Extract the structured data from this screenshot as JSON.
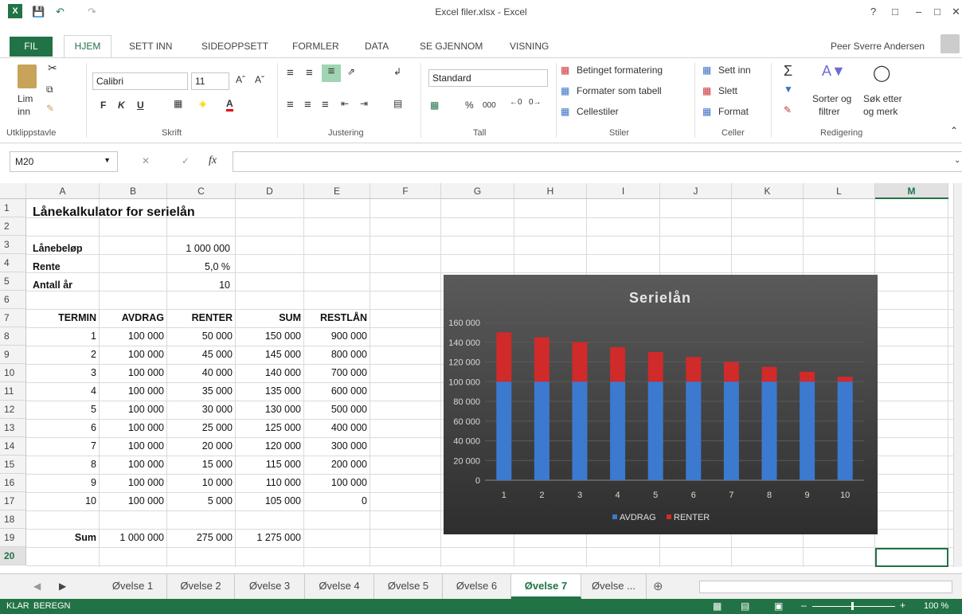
{
  "window": {
    "title": "Excel filer.xlsx - Excel",
    "user": "Peer Sverre Andersen"
  },
  "tabs": [
    "FIL",
    "HJEM",
    "SETT INN",
    "SIDEOPPSETT",
    "FORMLER",
    "DATA",
    "SE GJENNOM",
    "VISNING"
  ],
  "ribbon": {
    "clipboard": {
      "paste": "Lim",
      "paste2": "inn",
      "group": "Utklippstavle"
    },
    "font": {
      "name": "Calibri",
      "size": "11",
      "bold": "F",
      "italic": "K",
      "underline": "U",
      "group": "Skrift"
    },
    "alignment": {
      "group": "Justering"
    },
    "number": {
      "format": "Standard",
      "percent": "%",
      "thousands": "000",
      "group": "Tall"
    },
    "styles": {
      "cond": "Betinget formatering",
      "table": "Formater som tabell",
      "cell": "Cellestiler",
      "group": "Stiler"
    },
    "cells": {
      "insert": "Sett inn",
      "delete": "Slett",
      "format": "Format",
      "group": "Celler"
    },
    "editing": {
      "sort1": "Sorter og",
      "sort2": "filtrer",
      "find1": "Søk etter",
      "find2": "og merk",
      "group": "Redigering"
    }
  },
  "formula": {
    "namebox": "M20",
    "fx": "fx",
    "value": ""
  },
  "columns": [
    "A",
    "B",
    "C",
    "D",
    "E",
    "F",
    "G",
    "H",
    "I",
    "J",
    "K",
    "L",
    "M"
  ],
  "rows": [
    "1",
    "2",
    "3",
    "4",
    "5",
    "6",
    "7",
    "8",
    "9",
    "10",
    "11",
    "12",
    "13",
    "14",
    "15",
    "16",
    "17",
    "18",
    "19",
    "20"
  ],
  "sheet": {
    "title": "Lånekalkulator for serielån",
    "loan_label": "Lånebeløp",
    "loan_value": "1 000 000",
    "rate_label": "Rente",
    "rate_value": "5,0 %",
    "years_label": "Antall år",
    "years_value": "10",
    "headers": [
      "TERMIN",
      "AVDRAG",
      "RENTER",
      "SUM",
      "RESTLÅN"
    ],
    "table": [
      [
        "1",
        "100 000",
        "50 000",
        "150 000",
        "900 000"
      ],
      [
        "2",
        "100 000",
        "45 000",
        "145 000",
        "800 000"
      ],
      [
        "3",
        "100 000",
        "40 000",
        "140 000",
        "700 000"
      ],
      [
        "4",
        "100 000",
        "35 000",
        "135 000",
        "600 000"
      ],
      [
        "5",
        "100 000",
        "30 000",
        "130 000",
        "500 000"
      ],
      [
        "6",
        "100 000",
        "25 000",
        "125 000",
        "400 000"
      ],
      [
        "7",
        "100 000",
        "20 000",
        "120 000",
        "300 000"
      ],
      [
        "8",
        "100 000",
        "15 000",
        "115 000",
        "200 000"
      ],
      [
        "9",
        "100 000",
        "10 000",
        "110 000",
        "100 000"
      ],
      [
        "10",
        "100 000",
        "5 000",
        "105 000",
        "0"
      ]
    ],
    "sum": [
      "Sum",
      "1 000 000",
      "275 000",
      "1 275 000"
    ]
  },
  "chart_data": {
    "type": "bar",
    "stacked": true,
    "title": "Serielån",
    "categories": [
      "1",
      "2",
      "3",
      "4",
      "5",
      "6",
      "7",
      "8",
      "9",
      "10"
    ],
    "series": [
      {
        "name": "AVDRAG",
        "color": "#3c7ad0",
        "values": [
          100000,
          100000,
          100000,
          100000,
          100000,
          100000,
          100000,
          100000,
          100000,
          100000
        ]
      },
      {
        "name": "RENTER",
        "color": "#d02a2a",
        "values": [
          50000,
          45000,
          40000,
          35000,
          30000,
          25000,
          20000,
          15000,
          10000,
          5000
        ]
      }
    ],
    "ylim": [
      0,
      160000
    ],
    "yticks": [
      "0",
      "20 000",
      "40 000",
      "60 000",
      "80 000",
      "100 000",
      "120 000",
      "140 000",
      "160 000"
    ],
    "legend": "bottom",
    "grid": true
  },
  "sheet_tabs": [
    "Øvelse 1",
    "Øvelse 2",
    "Øvelse 3",
    "Øvelse 4",
    "Øvelse 5",
    "Øvelse 6",
    "Øvelse 7",
    "Øvelse ..."
  ],
  "active_tab": "Øvelse 7",
  "status": {
    "ready": "KLAR",
    "calc": "BEREGN",
    "zoom": "100 %"
  }
}
